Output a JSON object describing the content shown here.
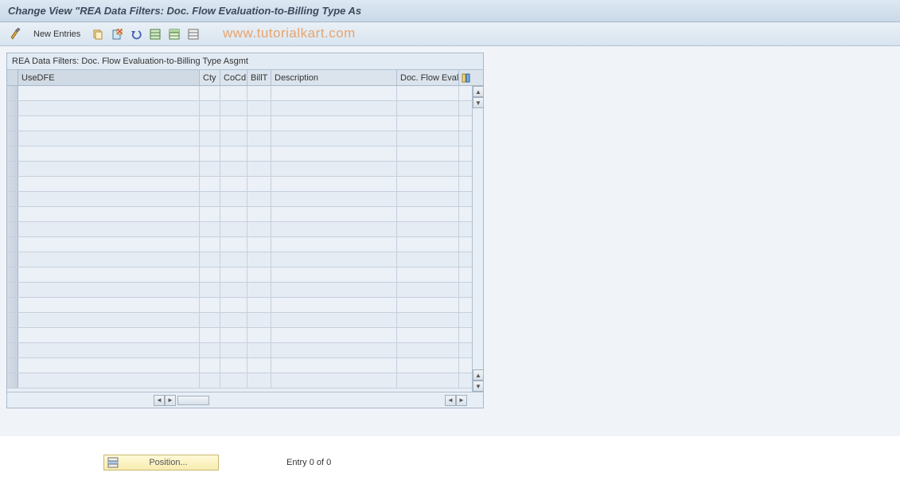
{
  "title": "Change View \"REA Data Filters: Doc. Flow Evaluation-to-Billing Type As",
  "watermark": "www.tutorialkart.com",
  "toolbar": {
    "new_entries_label": "New Entries"
  },
  "table": {
    "title": "REA Data Filters: Doc. Flow Evaluation-to-Billing Type Asgmt",
    "columns": {
      "usedfe": "UseDFE",
      "cty": "Cty",
      "cocd": "CoCd",
      "billt": "BillT",
      "description": "Description",
      "docflow": "Doc. Flow Eval."
    },
    "row_count": 20
  },
  "footer": {
    "position_label": "Position...",
    "entry_text": "Entry 0 of 0"
  }
}
